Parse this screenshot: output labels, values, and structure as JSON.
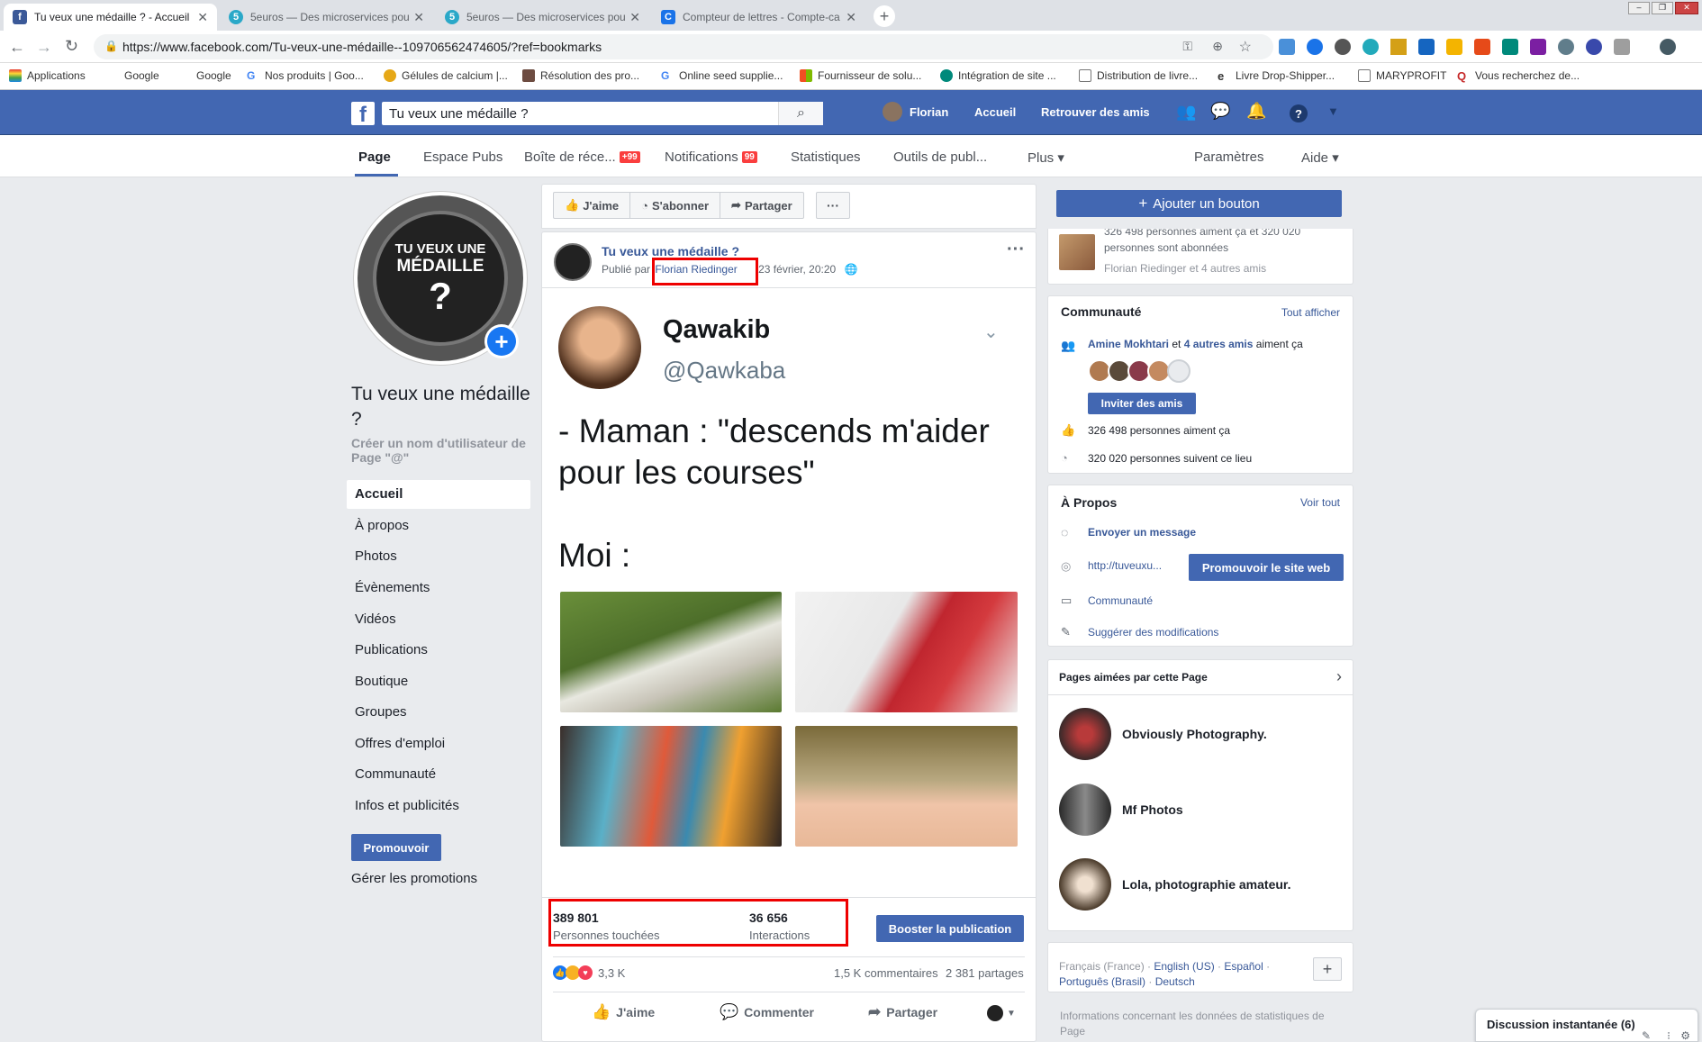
{
  "browser": {
    "tabs": [
      {
        "title": "Tu veux une médaille ? - Accueil",
        "icon": "f"
      },
      {
        "title": "5euros — Des microservices pour",
        "icon": "5"
      },
      {
        "title": "5euros — Des microservices pour",
        "icon": "5"
      },
      {
        "title": "Compteur de lettres - Compte-ca",
        "icon": "C"
      }
    ],
    "url": "https://www.facebook.com/Tu-veux-une-médaille--109706562474605/?ref=bookmarks",
    "bookmarks": [
      "Applications",
      "Google",
      "Google",
      "Nos produits | Goo...",
      "Gélules de calcium |...",
      "Résolution des pro...",
      "Online seed supplie...",
      "Fournisseur de solu...",
      "Intégration de site ...",
      "Distribution de livre...",
      "Livre Drop-Shipper...",
      "MARYPROFIT",
      "Vous recherchez de..."
    ]
  },
  "fb": {
    "search_value": "Tu veux une médaille ?",
    "user": "Florian",
    "nav_home": "Accueil",
    "nav_friends": "Retrouver des amis"
  },
  "pagetabs": {
    "page": "Page",
    "ads": "Espace Pubs",
    "inbox": "Boîte de réce...",
    "inbox_badge": "+99",
    "notifications": "Notifications",
    "notif_badge": "99",
    "stats": "Statistiques",
    "tools": "Outils de publ...",
    "more": "Plus ▾",
    "settings": "Paramètres",
    "help": "Aide ▾"
  },
  "left": {
    "avatar_line1": "TU VEUX UNE",
    "avatar_line2": "MÉDAILLE",
    "avatar_q": "?",
    "page_name": "Tu veux une médaille ?",
    "username_prompt": "Créer un nom d'utilisateur de Page \"@\"",
    "nav": [
      "Accueil",
      "À propos",
      "Photos",
      "Évènements",
      "Vidéos",
      "Publications",
      "Boutique",
      "Groupes",
      "Offres d'emploi",
      "Communauté",
      "Infos et publicités"
    ],
    "promote": "Promouvoir",
    "manage_promotions": "Gérer les promotions"
  },
  "actions": {
    "like": "J'aime",
    "subscribe": "S'abonner",
    "share": "Partager",
    "more": "···"
  },
  "add_button": "Ajouter un bouton",
  "post": {
    "page_name": "Tu veux une médaille ?",
    "published_by": "Publié par",
    "author": "Florian Riedinger",
    "date": "23 février, 20:20",
    "tweet_name": "Qawakib",
    "tweet_handle": "@Qawkaba",
    "tweet_line1": "- Maman : \"descends m'aider",
    "tweet_line2": "pour les courses\"",
    "tweet_line3": "Moi :",
    "reach_value": "389 801",
    "reach_label": "Personnes touchées",
    "interactions_value": "36 656",
    "interactions_label": "Interactions",
    "boost": "Booster la publication",
    "reactions": "3,3 K",
    "comments": "1,5 K commentaires",
    "shares": "2 381 partages",
    "btn_like": "J'aime",
    "btn_comment": "Commenter",
    "btn_share": "Partager"
  },
  "right": {
    "top_text1": "326 498 personnes aiment ça et 320 020",
    "top_text2": "personnes sont abonnées",
    "top_text3": "Florian Riedinger et 4 autres amis",
    "community_title": "Communauté",
    "see_all": "Tout afficher",
    "friends_like_name": "Amine Mokhtari",
    "friends_like_and": "et",
    "friends_like_others": "4 autres amis",
    "friends_like_suffix": "aiment ça",
    "invite": "Inviter des amis",
    "likes_count": "326 498 personnes aiment ça",
    "follow_count": "320 020 personnes suivent ce lieu",
    "about_title": "À Propos",
    "see_more": "Voir tout",
    "send_message": "Envoyer un message",
    "website": "http://tuveuxu...",
    "promote_site": "Promouvoir le site web",
    "community": "Communauté",
    "suggest": "Suggérer des modifications",
    "liked_pages_title": "Pages aimées par cette Page",
    "liked_pages": [
      "Obviously Photography.",
      "Mf Photos",
      "Lola, photographie amateur."
    ],
    "languages": [
      "Français (France)",
      "English (US)",
      "Español",
      "Português (Brasil)",
      "Deutsch"
    ],
    "stats_info": "Informations concernant les données de statistiques de Page",
    "chat": "Discussion instantanée (6)"
  },
  "colors": {
    "fb_blue": "#4267b2",
    "link": "#385898",
    "highlight_red": "#e00000",
    "chrome_bg": "#dee1e6"
  }
}
